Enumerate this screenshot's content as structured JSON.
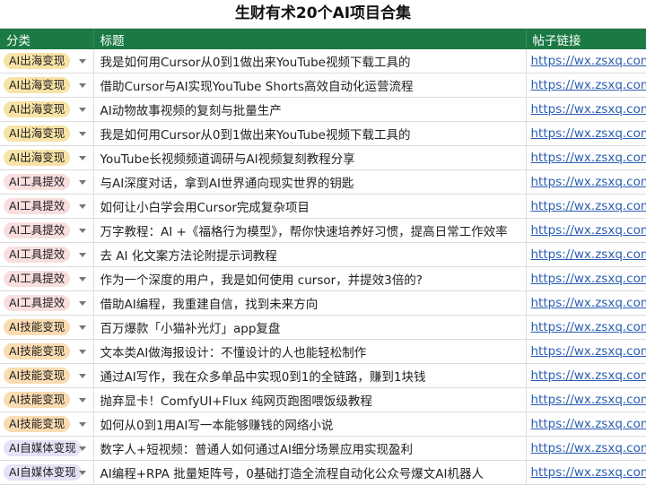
{
  "sheet_title": "生财有术20个AI项目合集",
  "headers": {
    "category": "分类",
    "title": "标题",
    "link": "帖子链接"
  },
  "category_colors": {
    "AI出海变现": "#f8e3a6",
    "AI工具提效": "#f9dede",
    "AI技能变现": "#fbdcb2",
    "AI自媒体变现": "#e4e2f6"
  },
  "rows": [
    {
      "category": "AI出海变现",
      "title": "我是如何用Cursor从0到1做出来YouTube视频下载工具的",
      "link": "https://wx.zsxq.com/"
    },
    {
      "category": "AI出海变现",
      "title": "借助Cursor与AI实现YouTube Shorts高效自动化运营流程",
      "link": "https://wx.zsxq.com/"
    },
    {
      "category": "AI出海变现",
      "title": "AI动物故事视频的复刻与批量生产",
      "link": "https://wx.zsxq.com/"
    },
    {
      "category": "AI出海变现",
      "title": "我是如何用Cursor从0到1做出来YouTube视频下载工具的",
      "link": "https://wx.zsxq.com/"
    },
    {
      "category": "AI出海变现",
      "title": "YouTube长视频频道调研与AI视频复刻教程分享",
      "link": "https://wx.zsxq.com/"
    },
    {
      "category": "AI工具提效",
      "title": "与AI深度对话，拿到AI世界通向现实世界的钥匙",
      "link": "https://wx.zsxq.com/"
    },
    {
      "category": "AI工具提效",
      "title": "如何让小白学会用Cursor完成复杂项目",
      "link": "https://wx.zsxq.com/"
    },
    {
      "category": "AI工具提效",
      "title": "万字教程：AI +《福格行为模型》，帮你快速培养好习惯，提高日常工作效率",
      "link": "https://wx.zsxq.com/"
    },
    {
      "category": "AI工具提效",
      "title": "去 AI 化文案方法论附提示词教程",
      "link": "https://wx.zsxq.com/"
    },
    {
      "category": "AI工具提效",
      "title": "作为一个深度的用户，我是如何使用 cursor，并提效3倍的?",
      "link": "https://wx.zsxq.com/"
    },
    {
      "category": "AI工具提效",
      "title": "借助AI编程，我重建自信，找到未来方向",
      "link": "https://wx.zsxq.com/"
    },
    {
      "category": "AI技能变现",
      "title": "百万爆款「小猫补光灯」app复盘",
      "link": "https://wx.zsxq.com/"
    },
    {
      "category": "AI技能变现",
      "title": "文本类AI做海报设计：不懂设计的人也能轻松制作",
      "link": "https://wx.zsxq.com/"
    },
    {
      "category": "AI技能变现",
      "title": "通过AI写作，我在众多单品中实现0到1的全链路，赚到1块钱",
      "link": "https://wx.zsxq.com/"
    },
    {
      "category": "AI技能变现",
      "title": "抛弃显卡！ComfyUI+Flux 纯网页跑图喂饭级教程",
      "link": "https://wx.zsxq.com/"
    },
    {
      "category": "AI技能变现",
      "title": "如何从0到1用AI写一本能够赚钱的网络小说",
      "link": "https://wx.zsxq.com/"
    },
    {
      "category": "AI自媒体变现",
      "title": "数字人+短视频：普通人如何通过AI细分场景应用实现盈利",
      "link": "https://wx.zsxq.com/"
    },
    {
      "category": "AI自媒体变现",
      "title": "AI编程+RPA 批量矩阵号，0基础打造全流程自动化公众号爆文AI机器人",
      "link": "https://wx.zsxq.com/"
    }
  ]
}
